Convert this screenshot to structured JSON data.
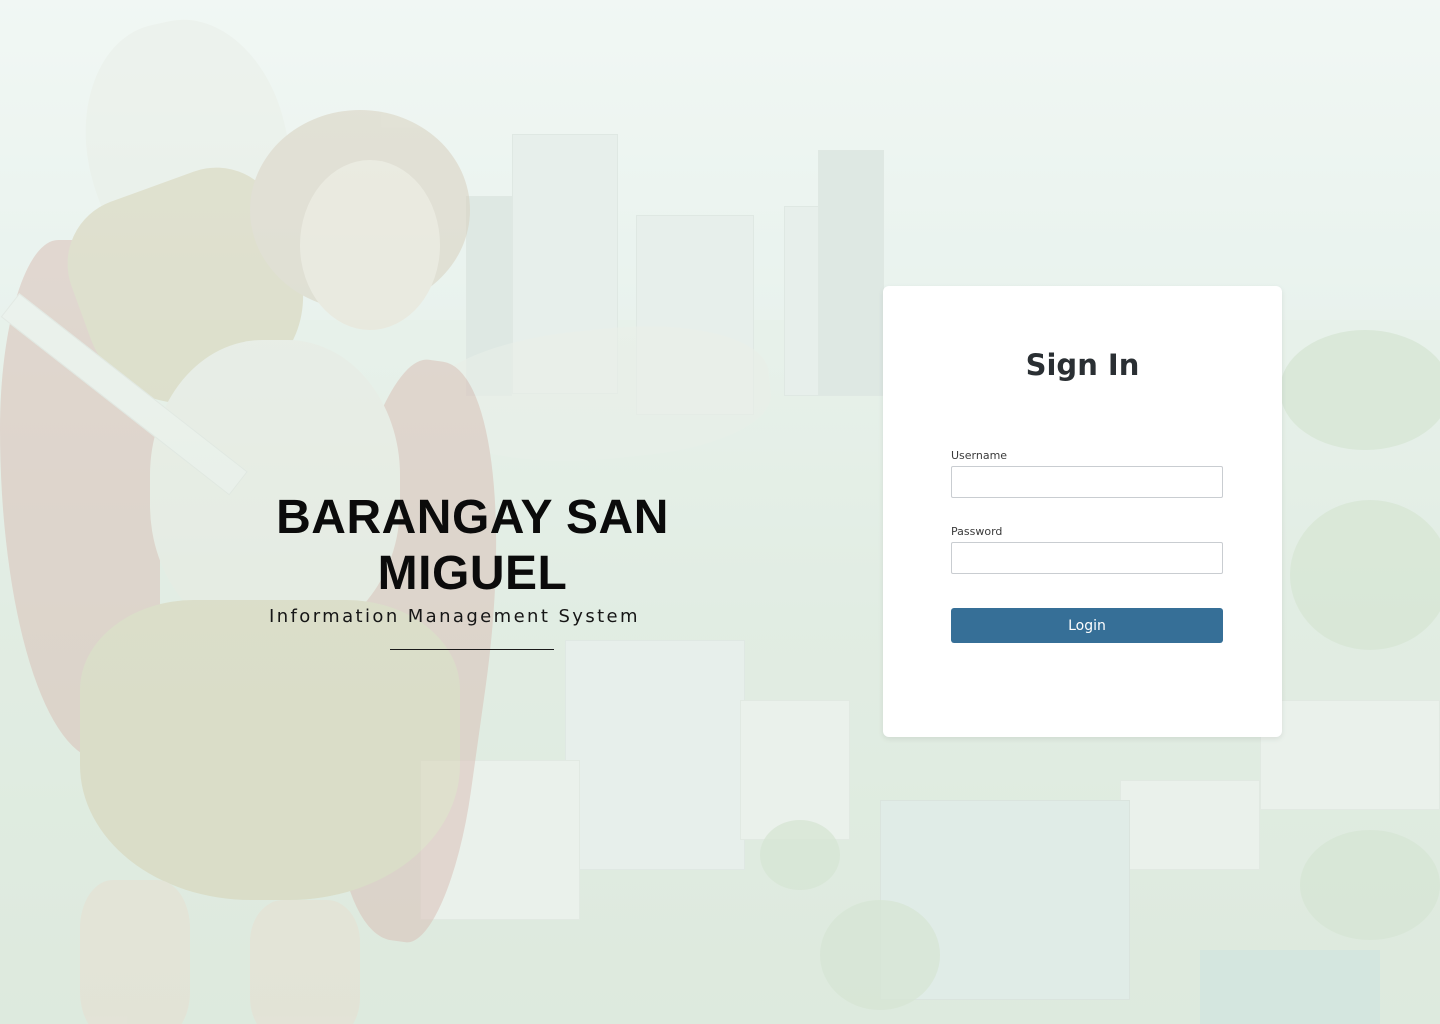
{
  "brand": {
    "title": "BARANGAY SAN MIGUEL",
    "subtitle": "Information Management System"
  },
  "login": {
    "heading": "Sign In",
    "username_label": "Username",
    "username_value": "",
    "password_label": "Password",
    "password_value": "",
    "button_label": "Login"
  },
  "colors": {
    "button": "#366f97",
    "card": "#ffffff",
    "title_text": "#0b0b0b"
  }
}
